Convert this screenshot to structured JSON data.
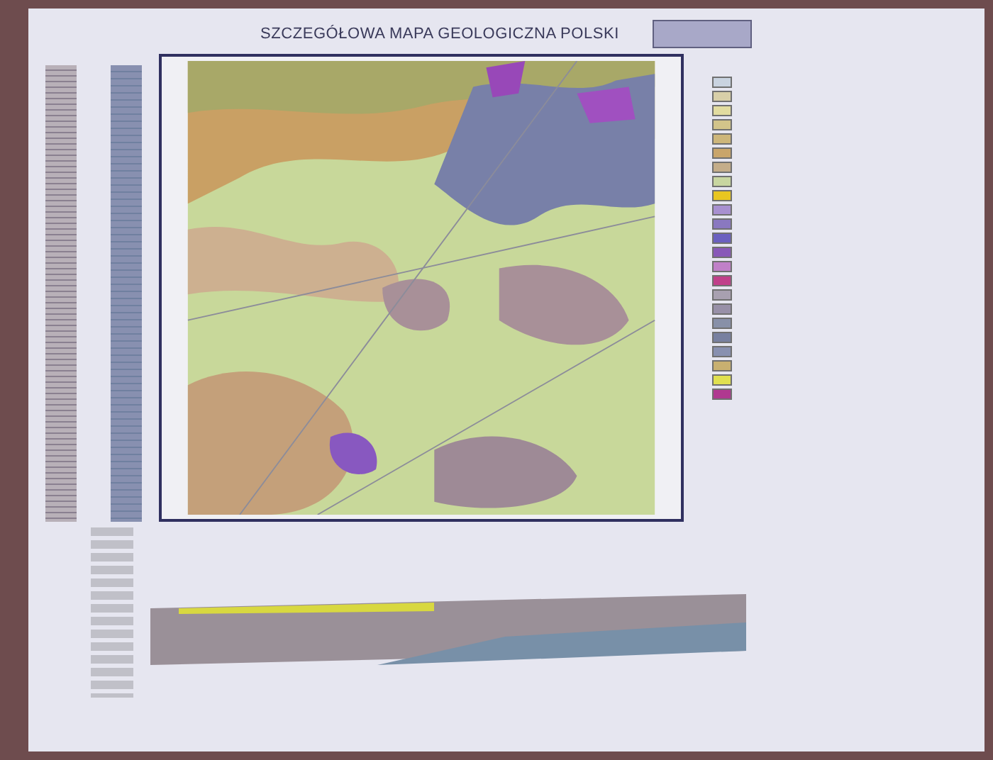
{
  "sheet": {
    "title": "SZCZEGÓŁOWA MAPA GEOLOGICZNA POLSKI"
  },
  "legend": {
    "swatches": [
      {
        "color": "#c9d3e0"
      },
      {
        "color": "#d8cfa8"
      },
      {
        "color": "#e2dca0"
      },
      {
        "color": "#d2c48a"
      },
      {
        "color": "#cdb67a"
      },
      {
        "color": "#c9a56a"
      },
      {
        "color": "#c4ad8a"
      },
      {
        "color": "#c8d6a0"
      },
      {
        "color": "#e8c620"
      },
      {
        "color": "#a890d0"
      },
      {
        "color": "#8a78c0"
      },
      {
        "color": "#6a60c0"
      },
      {
        "color": "#8858b8"
      },
      {
        "color": "#c080c8"
      },
      {
        "color": "#c0408a"
      },
      {
        "color": "#a8a0b0"
      },
      {
        "color": "#9890a8"
      },
      {
        "color": "#8890a8"
      },
      {
        "color": "#7880a0"
      },
      {
        "color": "#8890b0"
      },
      {
        "color": "#c8b070"
      },
      {
        "color": "#e0e050"
      },
      {
        "color": "#b03890"
      }
    ]
  }
}
